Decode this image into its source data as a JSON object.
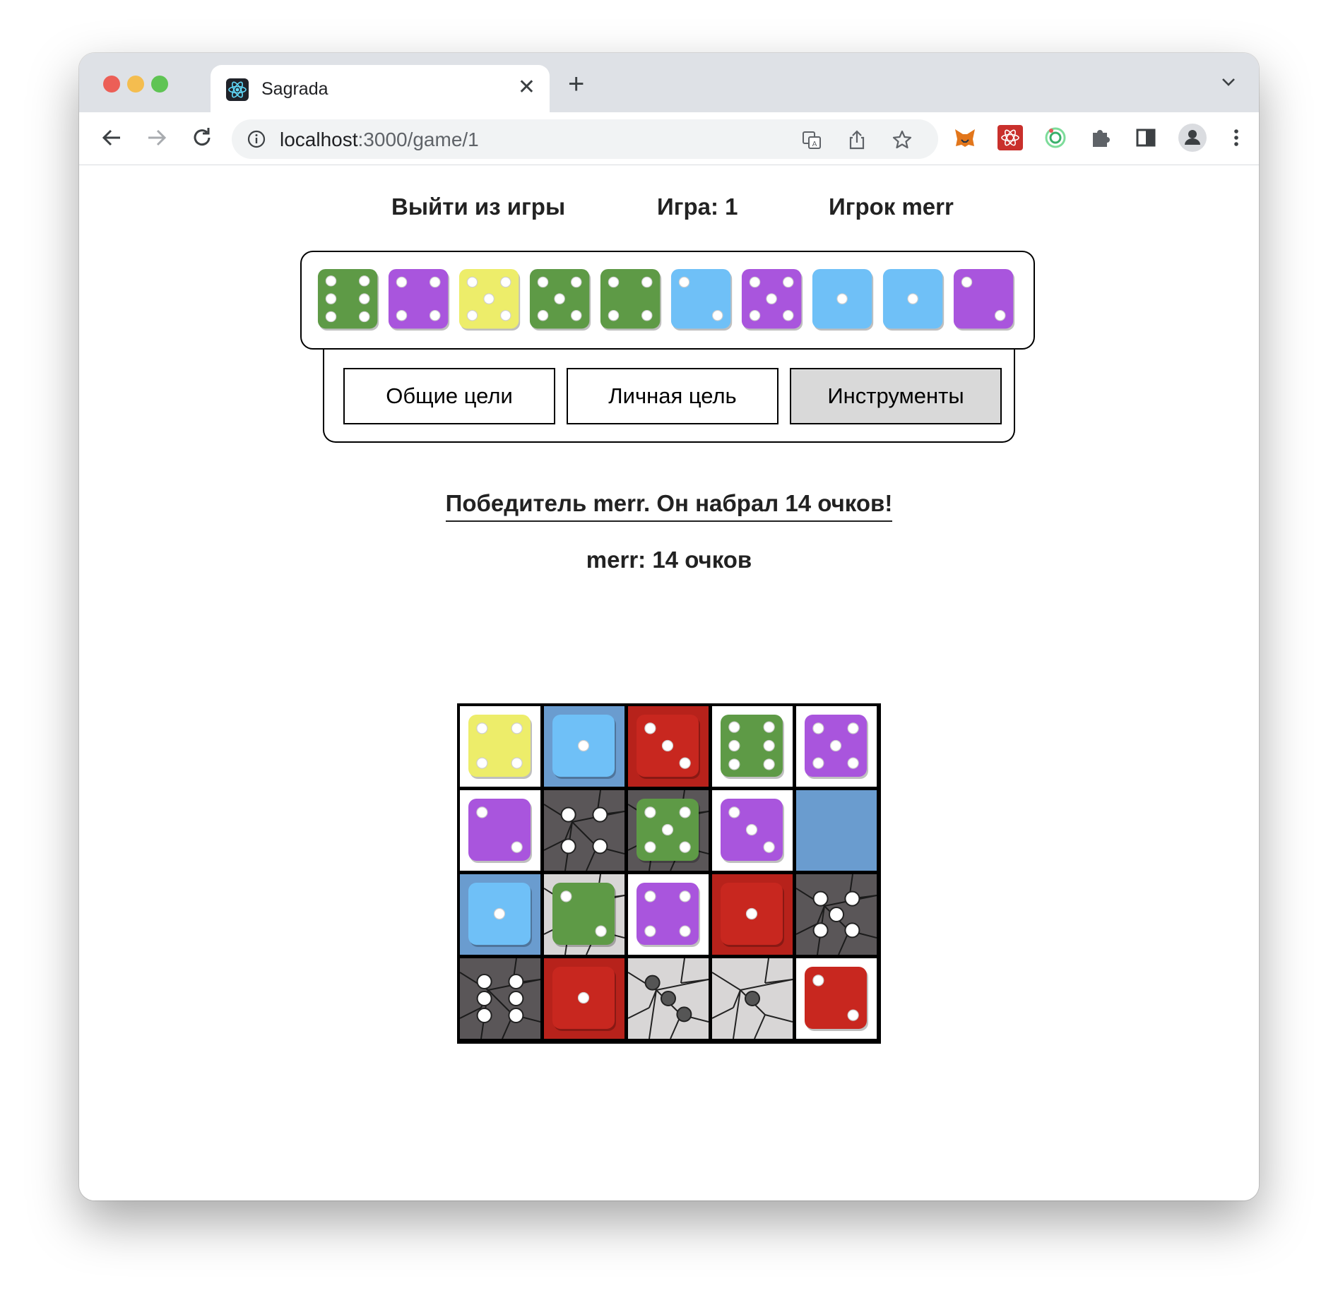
{
  "browser": {
    "tab_title": "Sagrada",
    "url_host": "localhost",
    "url_rest": ":3000/game/1"
  },
  "header": {
    "exit_label": "Выйти из игры",
    "game_label": "Игра: 1",
    "player_label": "Игрок merr"
  },
  "dice_pool": [
    {
      "color": "green",
      "value": 6
    },
    {
      "color": "purple",
      "value": 4
    },
    {
      "color": "yellow",
      "value": 5
    },
    {
      "color": "green",
      "value": 5
    },
    {
      "color": "green",
      "value": 4
    },
    {
      "color": "blue",
      "value": 2
    },
    {
      "color": "purple",
      "value": 5
    },
    {
      "color": "blue",
      "value": 1
    },
    {
      "color": "blue",
      "value": 1
    },
    {
      "color": "purple",
      "value": 2
    }
  ],
  "tabs": [
    {
      "label": "Общие цели",
      "active": false
    },
    {
      "label": "Личная цель",
      "active": false
    },
    {
      "label": "Инструменты",
      "active": true
    }
  ],
  "result": {
    "winner_text": "Победитель merr. Он набрал 14 очков!",
    "score_text": "merr: 14 очков"
  },
  "board": [
    [
      {
        "cell": "white",
        "die": {
          "color": "yellow",
          "value": 4
        }
      },
      {
        "cell": "blue",
        "die": {
          "color": "blue",
          "value": 1
        }
      },
      {
        "cell": "red",
        "die": {
          "color": "red",
          "value": 3
        }
      },
      {
        "cell": "white",
        "die": {
          "color": "green",
          "value": 6
        }
      },
      {
        "cell": "white",
        "die": {
          "color": "purple",
          "value": 5
        }
      }
    ],
    [
      {
        "cell": "white",
        "die": {
          "color": "purple",
          "value": 2
        }
      },
      {
        "cell": "shade",
        "shade": 4,
        "die": null
      },
      {
        "cell": "shade",
        "shade": 0,
        "die": {
          "color": "green",
          "value": 5
        }
      },
      {
        "cell": "white",
        "die": {
          "color": "purple",
          "value": 3
        }
      },
      {
        "cell": "blue",
        "die": null
      }
    ],
    [
      {
        "cell": "blue",
        "die": {
          "color": "blue",
          "value": 1
        }
      },
      {
        "cell": "light-shade",
        "die": {
          "color": "green",
          "value": 2
        }
      },
      {
        "cell": "white",
        "die": {
          "color": "purple",
          "value": 4
        }
      },
      {
        "cell": "red",
        "die": {
          "color": "red",
          "value": 1
        }
      },
      {
        "cell": "shade",
        "shade": 5,
        "die": null
      }
    ],
    [
      {
        "cell": "shade",
        "shade": 6,
        "die": null
      },
      {
        "cell": "red",
        "die": {
          "color": "red",
          "value": 1
        }
      },
      {
        "cell": "light-shade",
        "shade": 3,
        "die": null
      },
      {
        "cell": "light-shade",
        "shade": 1,
        "die": null
      },
      {
        "cell": "white",
        "die": {
          "color": "red",
          "value": 2
        }
      }
    ]
  ],
  "colors": {
    "green": "#5e9a46",
    "purple": "#a955dd",
    "yellow": "#eded6a",
    "blue": "#6fc0f7",
    "red": "#c8271f",
    "cell_blue": "#6a9ccf",
    "cell_red": "#b7221b"
  }
}
